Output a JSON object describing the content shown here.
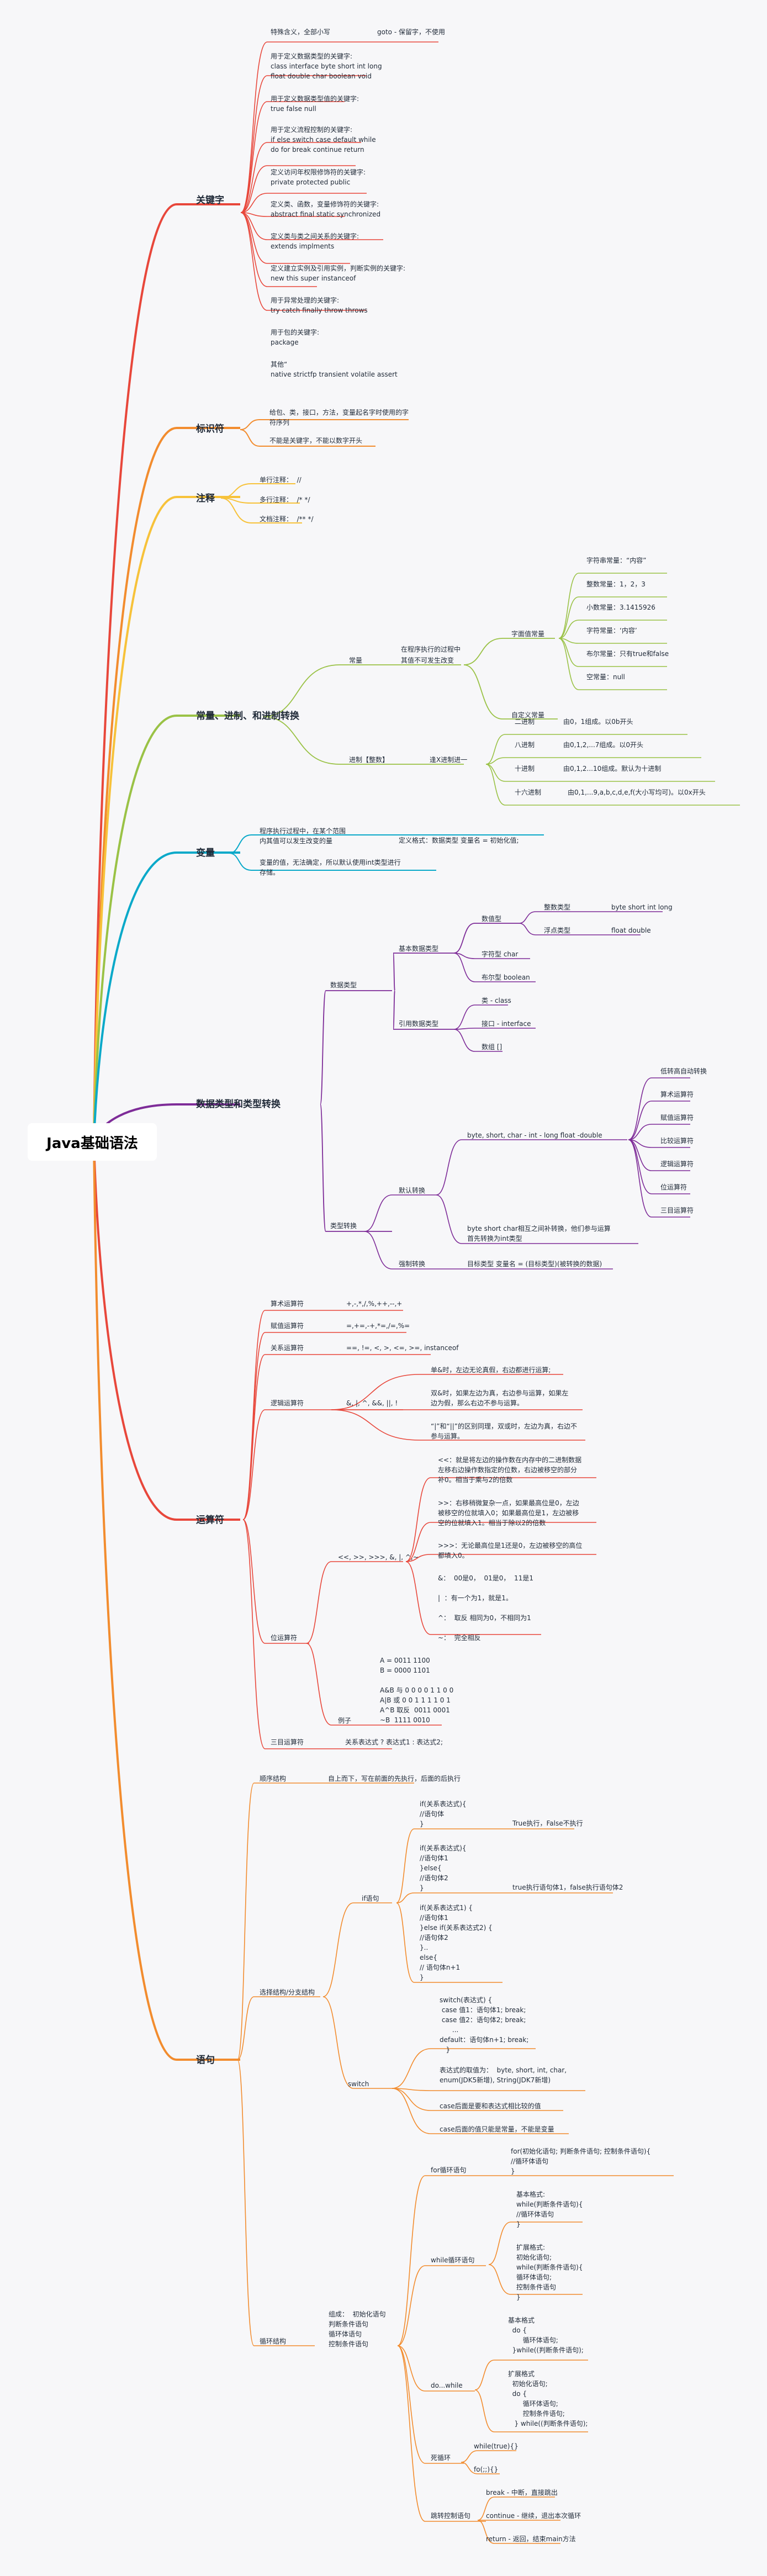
{
  "root": "Java基础语法",
  "colors": {
    "keyword": "#e8473b",
    "identifier": "#f28c2e",
    "comment": "#f7c23a",
    "constant": "#9ac246",
    "variable": "#0aa9c9",
    "datatype": "#7e2c98",
    "operator": "#e8473b",
    "statement": "#f28c2e"
  },
  "branches": {
    "keyword": {
      "title": "关键字",
      "items": [
        "特殊含义，全部小写",
        "goto - 保留字，不使用",
        "用于定义数据类型的关键字:\nclass interface byte short int long\nfloat double char boolean void",
        "用于定义数据类型值的关键字:\ntrue false null",
        "用于定义流程控制的关键字:\nif else switch case default while\ndo for break continue return",
        "定义访问年权限修饰符的关键字:\nprivate protected public",
        "定义类、函数，变量修饰符的关键字:\nabstract final static synchronized",
        "定义类与类之间关系的关键字:\nextends implments",
        "定义建立实例及引用实例，判断实例的关键字:\nnew this super instanceof",
        "用于异常处理的关键字:\ntry catch finally throw throws",
        "用于包的关键字:\npackage",
        "其他“\nnative strictfp transient volatile assert"
      ]
    },
    "identifier": {
      "title": "标识符",
      "items": [
        "给包、类，接口，方法，变量起名字时使用的字\n符序列",
        "不能是关键字，不能以数字开头"
      ]
    },
    "comment": {
      "title": "注释",
      "items": [
        "单行注释：  //",
        "多行注释：  /* */",
        "文档注释：  /** */"
      ]
    },
    "constant": {
      "title": "常量、进制、和进制转换",
      "const_label": "常量",
      "const_desc": "在程序执行的过程中\n其值不可发生改变",
      "literal_label": "字面值常量",
      "literals": [
        "字符串常量：“内容”",
        "整数常量：1，2，3",
        "小数常量：3.1415926",
        "字符常量：‘内容’",
        "布尔常量：只有true和false",
        "空常量：null"
      ],
      "custom_label": "自定义常量",
      "radix_label": "进制【整数】",
      "radix_desc": "逢X进制进一",
      "radix": [
        {
          "name": "二进制",
          "desc": "由0，1组成。以0b开头"
        },
        {
          "name": "八进制",
          "desc": "由0,1,2,...7组成。以0开头"
        },
        {
          "name": "十进制",
          "desc": "由0,1,2...10组成。默认为十进制"
        },
        {
          "name": "十六进制",
          "desc": "由0,1,...9,a,b,c,d,e,f(大小写均可)。以0x开头"
        }
      ]
    },
    "variable": {
      "title": "变量",
      "items": [
        "程序执行过程中，在某个范围\n内其值可以发生改变的量",
        "定义格式：数据类型 变量名 = 初始化值;",
        "变量的值，无法确定，所以默认使用int类型进行\n存储。"
      ]
    },
    "datatype": {
      "title": "数据类型和类型转换",
      "types_label": "数据类型",
      "basic_label": "基本数据类型",
      "numeric_label": "数值型",
      "int_label": "整数类型",
      "int_val": "byte short int long",
      "float_label": "浮点类型",
      "float_val": "float double",
      "char_label": "字符型 char",
      "bool_label": "布尔型 boolean",
      "ref_label": "引用数据类型",
      "refs": [
        "类 - class",
        "接口 - interface",
        "数组 []"
      ],
      "conv_label": "类型转换",
      "default_label": "默认转换",
      "order": "byte, short, char - int - long float -double",
      "order_items": [
        "低转高自动转换",
        "算术运算符",
        "赋值运算符",
        "比较运算符",
        "逻辑运算符",
        "位运算符",
        "三目运算符"
      ],
      "bsc": "byte short char相互之间补转换，他们参与运算\n首先转换为int类型",
      "force_label": "强制转换",
      "force_val": "目标类型 变量名 = (目标类型)(被转换的数据)"
    },
    "operator": {
      "title": "运算符",
      "arith": [
        "算术运算符",
        "+,-,*,/,%,++,--,+"
      ],
      "assign": [
        "赋值运算符",
        "=,+=,-+,*=,/=,%="
      ],
      "relation": [
        "关系运算符",
        "==, !=, <, >, <=, >=, instanceof"
      ],
      "logic": [
        "逻辑运算符",
        "&, |, ^, &&, ||, !"
      ],
      "logic_items": [
        "单&时，左边无论真假，右边都进行运算;",
        "双&时，如果左边为真，右边参与运算，如果左\n边为假，那么右边不参与运算。",
        "“|”和“||”的区别同理，双或时，左边为真，右边不\n参与运算。"
      ],
      "bit_label": "位运算符",
      "bit_ops": "<<, >>, >>>, &, |, ^,~",
      "bit_items": [
        "<<：就是将左边的操作数在内存中的二进制数据\n左移右边操作数指定的位数，右边被移空的部分\n补0。相当于乘与2的倍数",
        ">>：右移稍微复杂一点，如果最高位是0，左边\n被移空的位就填入0；如果最高位是1，左边被移\n空的位就填入1。相当于除以2的倍数",
        ">>>：无论最高位是1还是0，左边被移空的高位\n都填入0。",
        "&：  00是0，  01是0，  11是1\n\n|  ：有一个为1，就是1。\n\n^：  取反 相同为0，不相同为1\n\n~：  完全相反"
      ],
      "example_label": "例子",
      "example": "A = 0011 1100\nB = 0000 1101\n\nA&B 与 0 0 0 0 1 1 0 0\nA|B 或 0 0 1 1 1 1 0 1\nA^B 取反  0011 0001\n~B  1111 0010",
      "ternary": [
        "三目运算符",
        "关系表达式 ? 表达式1 : 表达式2;"
      ]
    },
    "statement": {
      "title": "语句",
      "seq": [
        "顺序结构",
        "自上而下，写在前面的先执行，后面的后执行"
      ],
      "select_label": "选择结构/分支结构",
      "if_label": "if语句",
      "if_items": [
        {
          "code": "if(关系表达式){\n//语句体\n}",
          "note": "True执行，False不执行"
        },
        {
          "code": "if(关系表达式){\n//语句体1\n}else{\n//语句体2\n}",
          "note": "true执行语句体1，false执行语句体2"
        },
        {
          "code": "if(关系表达式1) {\n//语句体1\n}else if(关系表达式2) {\n//语句体2\n}..\nelse{\n// 语句体n+1\n}",
          "note": ""
        }
      ],
      "switch_label": "switch",
      "switch_items": [
        "switch(表达式) {\n case 值1：语句体1; break;\n case 值2：语句体2; break;\n      ...\ndefault：语句体n+1; break;\n   }",
        "表达式的取值为：  byte, short, int, char,\nenum(JDK5新增), String(JDK7新增)",
        "case后面是要和表达式相比较的值",
        "case后面的值只能是常量，不能是变量"
      ],
      "loop_label": "循环结构",
      "loop_desc": "组成：  初始化语句\n判断条件语句\n循环体语句\n控制条件语句",
      "for_label": "for循环语句",
      "for_code": "for(初始化语句; 判断条件语句; 控制条件语句){\n//循环体语句\n}",
      "while_label": "while循环语句",
      "while_items": [
        "基本格式:\nwhile(判断条件语句){\n//循环体语句\n}",
        "扩展格式:\n初始化语句;\nwhile(判断条件语句){\n循环体语句;\n控制条件语句\n}"
      ],
      "dowhile_label": "do...while",
      "dowhile_items": [
        "基本格式\n  do {\n       循环体语句;\n  }while((判断条件语句);",
        "扩展格式\n  初始化语句;\n  do {\n       循环体语句;\n       控制条件语句;\n   } while((判断条件语句);"
      ],
      "dead_label": "死循环",
      "dead_items": [
        "while(true){}",
        "fo(;;){}"
      ],
      "jump_label": "跳转控制语句",
      "jump_items": [
        "break - 中断，直接跳出",
        "continue - 继续，退出本次循环",
        "return - 返回，结束main方法"
      ]
    }
  }
}
